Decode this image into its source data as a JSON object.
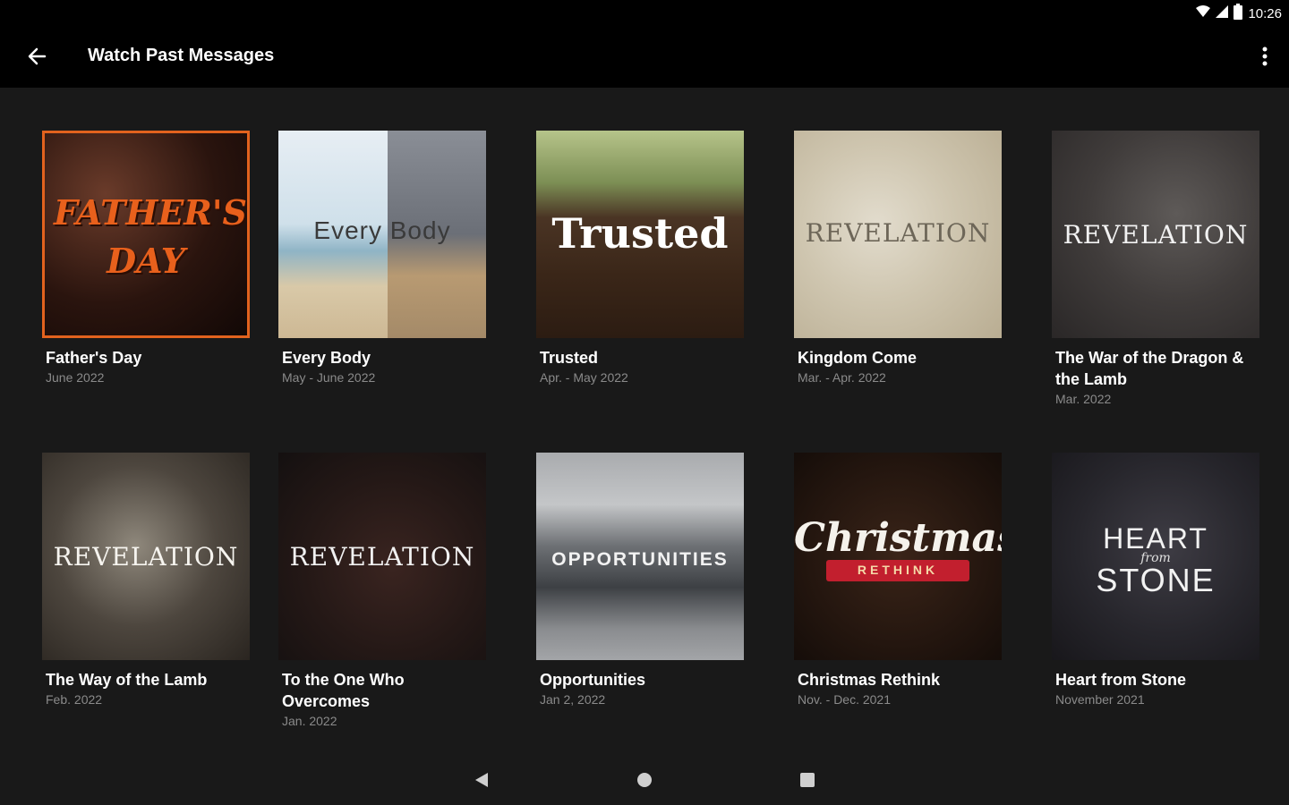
{
  "status": {
    "time": "10:26"
  },
  "appbar": {
    "title": "Watch Past Messages",
    "back_icon": "arrow-left-icon",
    "menu_icon": "more-vert-icon"
  },
  "colors": {
    "accent": "#e2621e",
    "background": "#191919",
    "bar": "#000000",
    "subtitle": "#8a8a8a"
  },
  "series": [
    {
      "title": "Father's Day",
      "date": "June 2022",
      "art_text": "FATHER'S DAY",
      "selected": true
    },
    {
      "title": "Every Body",
      "date": "May - June 2022",
      "art_text": "Every Body"
    },
    {
      "title": "Trusted",
      "date": "Apr. - May 2022",
      "art_text": "Trusted"
    },
    {
      "title": "Kingdom Come",
      "date": "Mar. - Apr. 2022",
      "art_text": "REVELATION"
    },
    {
      "title": "The War of the Dragon & the Lamb",
      "date": "Mar. 2022",
      "art_text": "REVELATION"
    },
    {
      "title": "The Way of the Lamb",
      "date": "Feb. 2022",
      "art_text": "REVELATION"
    },
    {
      "title": "To the One Who Overcomes",
      "date": "Jan. 2022",
      "art_text": "REVELATION"
    },
    {
      "title": "Opportunities",
      "date": "Jan 2, 2022",
      "art_text": "OPPORTUNITIES"
    },
    {
      "title": "Christmas Rethink",
      "date": "Nov. - Dec. 2021",
      "art_text": "Christmas",
      "art_subtext": "RETHINK"
    },
    {
      "title": "Heart from Stone",
      "date": "November 2021",
      "art_text": "HEART",
      "art_subtext": "from",
      "art_text2": "STONE"
    }
  ],
  "navbar": {
    "back_icon": "triangle-back-icon",
    "home_icon": "circle-home-icon",
    "recents_icon": "square-recents-icon"
  }
}
